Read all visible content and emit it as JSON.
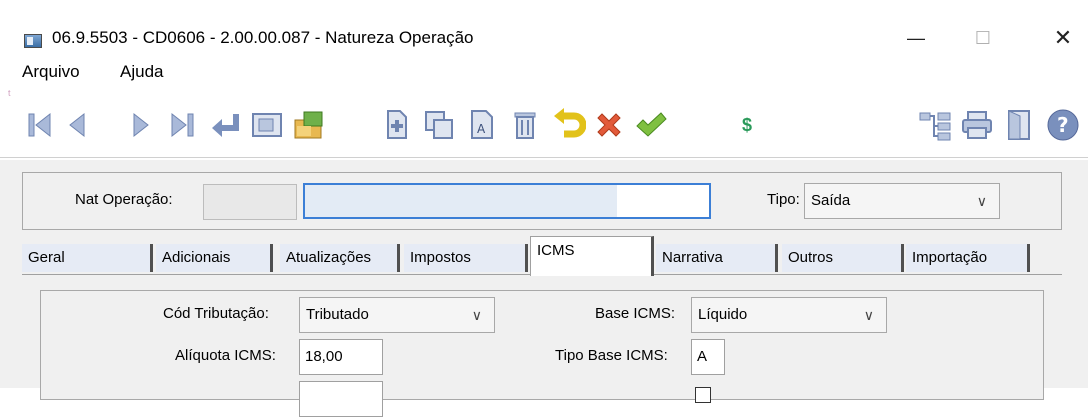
{
  "window": {
    "title": "06.9.5503 - CD0606 - 2.00.00.087 - Natureza Operação",
    "minimize": "—",
    "maximize": "☐",
    "close": "✕"
  },
  "menu": {
    "items": [
      "Arquivo",
      "Ajuda"
    ]
  },
  "toolbar": {
    "buttons": [
      {
        "icon": "first-record-icon"
      },
      {
        "icon": "previous-record-icon"
      },
      {
        "icon": "next-record-icon"
      },
      {
        "icon": "last-record-icon"
      },
      {
        "icon": "return-icon"
      },
      {
        "icon": "zoom-icon"
      },
      {
        "icon": "edit-folder-icon"
      },
      {
        "icon": "new-document-icon"
      },
      {
        "icon": "copy-icon"
      },
      {
        "icon": "rename-icon"
      },
      {
        "icon": "delete-icon"
      },
      {
        "icon": "undo-icon"
      },
      {
        "icon": "cancel-icon"
      },
      {
        "icon": "confirm-icon"
      },
      {
        "icon": "currency-icon"
      },
      {
        "icon": "tree-icon"
      },
      {
        "icon": "print-icon"
      },
      {
        "icon": "exit-icon"
      },
      {
        "icon": "help-icon"
      }
    ],
    "currency_symbol": "$",
    "help_symbol": "?"
  },
  "header": {
    "nat_operacao_label": "Nat Operação:",
    "nat_operacao_code": "",
    "nat_operacao_desc": "",
    "tipo_label": "Tipo:",
    "tipo_value": "Saída",
    "chevron": "∨"
  },
  "tabs": [
    {
      "label": "Geral",
      "active": false
    },
    {
      "label": "Adicionais",
      "active": false
    },
    {
      "label": "Atualizações",
      "active": false
    },
    {
      "label": "Impostos",
      "active": false
    },
    {
      "label": "ICMS",
      "active": true
    },
    {
      "label": "Narrativa",
      "active": false
    },
    {
      "label": "Outros",
      "active": false
    },
    {
      "label": "Importação",
      "active": false
    }
  ],
  "icms": {
    "cod_tributacao_label": "Cód Tributação:",
    "cod_tributacao_value": "Tributado",
    "aliquota_label": "Alíquota ICMS:",
    "aliquota_value": "18,00",
    "base_icms_label": "Base ICMS:",
    "base_icms_value": "Líquido",
    "tipo_base_label": "Tipo Base ICMS:",
    "tipo_base_value": "A",
    "chevron": "∨"
  },
  "colors": {
    "focus_border": "#3c7fd6",
    "panel_bg": "#f0f0f0",
    "tab_bg": "#e6ebf5"
  }
}
